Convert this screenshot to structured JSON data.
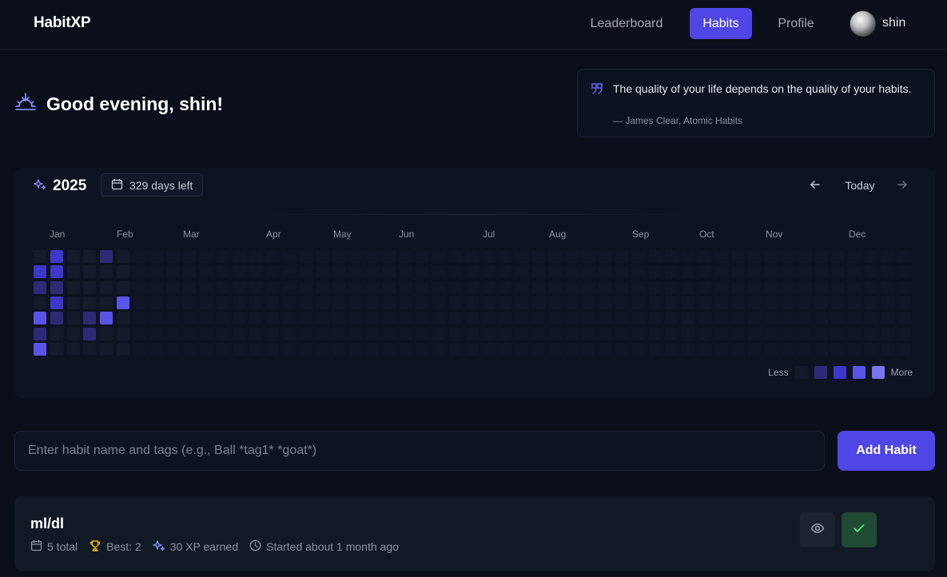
{
  "nav": {
    "brand": "HabitXP",
    "links": [
      {
        "label": "Leaderboard"
      },
      {
        "label": "Habits",
        "active": true
      },
      {
        "label": "Profile"
      }
    ],
    "user": {
      "name": "shin"
    }
  },
  "greeting": {
    "text": "Good evening, shin!",
    "icon": "sunrise-icon"
  },
  "quote": {
    "text": "The quality of your life depends on the quality of your habits.",
    "author": "— James Clear, Atomic Habits",
    "icon": "quote-icon"
  },
  "heatmap": {
    "year": "2025",
    "days_left": "329 days left",
    "today_label": "Today",
    "months": [
      "Jan",
      "Feb",
      "Mar",
      "Apr",
      "May",
      "Jun",
      "Jul",
      "Aug",
      "Sep",
      "Oct",
      "Nov",
      "Dec"
    ],
    "legend": {
      "less": "Less",
      "more": "More"
    },
    "colors": {
      "empty_past": "#161b2b",
      "empty_future": "#111626",
      "level1": "#2e2a77",
      "level2": "#3f37c9",
      "level3": "#5b54e8",
      "level4": "#7b74f0"
    },
    "active_cells": [
      {
        "week": 1,
        "day": 0,
        "level": 2
      },
      {
        "week": 4,
        "day": 0,
        "level": 1
      },
      {
        "week": 0,
        "day": 1,
        "level": 2
      },
      {
        "week": 1,
        "day": 1,
        "level": 2
      },
      {
        "week": 0,
        "day": 2,
        "level": 1
      },
      {
        "week": 1,
        "day": 2,
        "level": 1
      },
      {
        "week": 1,
        "day": 3,
        "level": 2
      },
      {
        "week": 5,
        "day": 3,
        "level": 3
      },
      {
        "week": 0,
        "day": 4,
        "level": 3
      },
      {
        "week": 1,
        "day": 4,
        "level": 1
      },
      {
        "week": 3,
        "day": 4,
        "level": 1
      },
      {
        "week": 4,
        "day": 4,
        "level": 3
      },
      {
        "week": 0,
        "day": 5,
        "level": 1
      },
      {
        "week": 3,
        "day": 5,
        "level": 1
      },
      {
        "week": 0,
        "day": 6,
        "level": 3
      }
    ],
    "past_through_week": 5
  },
  "add_habit": {
    "placeholder": "Enter habit name and tags (e.g., Ball *tag1* *goat*)",
    "button_label": "Add Habit"
  },
  "habits": [
    {
      "name": "ml/dl",
      "total": "5 total",
      "best": "Best: 2",
      "xp": "30 XP earned",
      "started": "Started about 1 month ago",
      "colors": {
        "trophy": "#eab308",
        "xp": "#818cf8"
      }
    }
  ]
}
